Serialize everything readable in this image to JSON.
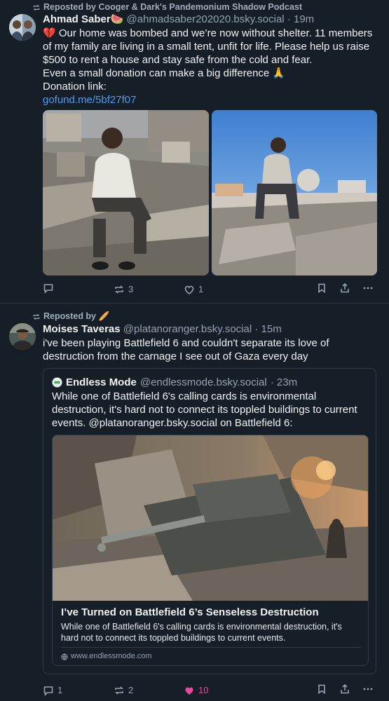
{
  "post1": {
    "repost_label": "Reposted by Cooger & Dark's Pandemonium Shadow Podcast",
    "author": "Ahmad Saber🍉",
    "handle": "@ahmadsaber202020.bsky.social",
    "time": "· 19m",
    "text_line1": "💔 Our home was bombed and we’re now without shelter. 11 members of my family are living in a small tent, unfit for life. Please help us raise $500 to rent a house and stay safe from the cold and fear.",
    "text_line2": "Even a small donation can make a big difference 🙏",
    "text_line3": "Donation link:",
    "link": "gofund.me/5bf27f07",
    "reply_count": "",
    "repost_count": "3",
    "like_count": "1"
  },
  "post2": {
    "repost_label": "Reposted by 🥖",
    "author": "Moises Taveras",
    "handle": "@platanoranger.bsky.social",
    "time": "· 15m",
    "text": "i've been playing Battlefield 6 and couldn't separate its love of destruction from the carnage I see out of Gaza every day",
    "quote": {
      "author": "Endless Mode",
      "handle": "@endlessmode.bsky.social",
      "time": "· 23m",
      "text": "While one of Battlefield 6's calling cards is environmental destruction, it's hard not to connect its toppled buildings to current events. @platanoranger.bsky.social on Battlefield 6:",
      "card_title": "I’ve Turned on Battlefield 6’s Senseless Destruction",
      "card_desc": "While one of Battlefield 6's calling cards is environmental destruction, it's hard not to connect its toppled buildings to current events.",
      "card_domain": "www.endlessmode.com"
    },
    "reply_count": "1",
    "repost_count": "2",
    "like_count": "10"
  },
  "colors": {
    "background": "#161e27",
    "link": "#4d9cf6",
    "muted": "#93a3b3",
    "like_active": "#ec4899"
  }
}
